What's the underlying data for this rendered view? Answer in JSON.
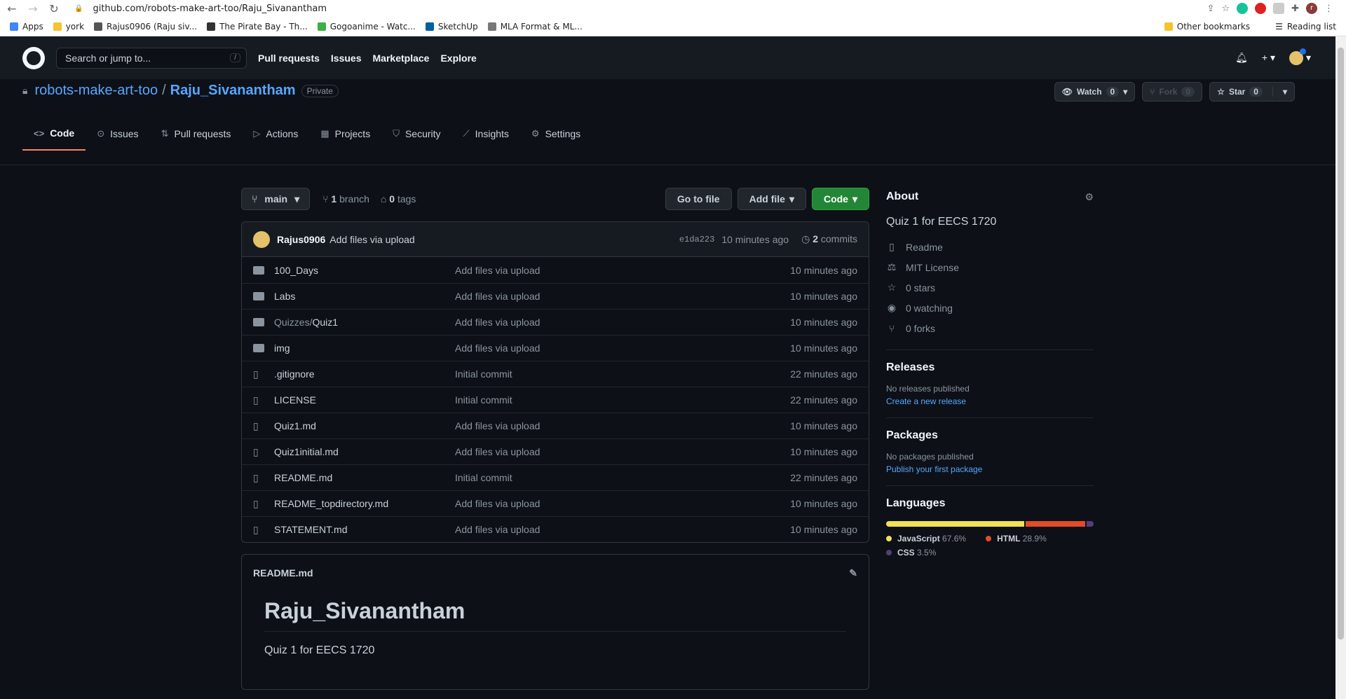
{
  "browser": {
    "url": "github.com/robots-make-art-too/Raju_Sivanantham",
    "bookmarks": [
      {
        "label": "Apps",
        "color": "#4285f4"
      },
      {
        "label": "york",
        "color": "#f4c430"
      },
      {
        "label": "Rajus0906 (Raju siv...",
        "color": "#555555"
      },
      {
        "label": "The Pirate Bay - Th...",
        "color": "#333333"
      },
      {
        "label": "Gogoanime - Watc...",
        "color": "#3cb043"
      },
      {
        "label": "SketchUp",
        "color": "#005f9e"
      },
      {
        "label": "MLA Format & ML...",
        "color": "#777777"
      }
    ],
    "other_bookmarks": "Other bookmarks",
    "reading_list": "Reading list",
    "profile_initial": "r"
  },
  "header": {
    "search_placeholder": "Search or jump to...",
    "slash": "/",
    "nav": [
      "Pull requests",
      "Issues",
      "Marketplace",
      "Explore"
    ]
  },
  "repo": {
    "owner": "robots-make-art-too",
    "name": "Raju_Sivanantham",
    "visibility": "Private",
    "watch_label": "Watch",
    "watch_count": "0",
    "fork_label": "Fork",
    "fork_count": "0",
    "star_label": "Star",
    "star_count": "0"
  },
  "tabs": [
    {
      "label": "Code",
      "icon": "code-icon"
    },
    {
      "label": "Issues",
      "icon": "issue-icon"
    },
    {
      "label": "Pull requests",
      "icon": "pull-request-icon"
    },
    {
      "label": "Actions",
      "icon": "play-icon"
    },
    {
      "label": "Projects",
      "icon": "table-icon"
    },
    {
      "label": "Security",
      "icon": "shield-icon"
    },
    {
      "label": "Insights",
      "icon": "graph-icon"
    },
    {
      "label": "Settings",
      "icon": "gear-icon"
    }
  ],
  "branch": {
    "current": "main",
    "branch_count": "1",
    "branch_word": "branch",
    "tag_count": "0",
    "tag_word": "tags",
    "go_to_file": "Go to file",
    "add_file": "Add file",
    "code": "Code"
  },
  "commit": {
    "user": "Rajus0906",
    "message": "Add files via upload",
    "sha": "e1da223",
    "age": "10 minutes ago",
    "count": "2",
    "count_word": "commits"
  },
  "files": [
    {
      "type": "dir",
      "prefix": "",
      "name": "100_Days",
      "message": "Add files via upload",
      "age": "10 minutes ago"
    },
    {
      "type": "dir",
      "prefix": "",
      "name": "Labs",
      "message": "Add files via upload",
      "age": "10 minutes ago"
    },
    {
      "type": "dir",
      "prefix": "Quizzes/",
      "name": "Quiz1",
      "message": "Add files via upload",
      "age": "10 minutes ago"
    },
    {
      "type": "dir",
      "prefix": "",
      "name": "img",
      "message": "Add files via upload",
      "age": "10 minutes ago"
    },
    {
      "type": "file",
      "prefix": "",
      "name": ".gitignore",
      "message": "Initial commit",
      "age": "22 minutes ago"
    },
    {
      "type": "file",
      "prefix": "",
      "name": "LICENSE",
      "message": "Initial commit",
      "age": "22 minutes ago"
    },
    {
      "type": "file",
      "prefix": "",
      "name": "Quiz1.md",
      "message": "Add files via upload",
      "age": "10 minutes ago"
    },
    {
      "type": "file",
      "prefix": "",
      "name": "Quiz1initial.md",
      "message": "Add files via upload",
      "age": "10 minutes ago"
    },
    {
      "type": "file",
      "prefix": "",
      "name": "README.md",
      "message": "Initial commit",
      "age": "22 minutes ago"
    },
    {
      "type": "file",
      "prefix": "",
      "name": "README_topdirectory.md",
      "message": "Add files via upload",
      "age": "10 minutes ago"
    },
    {
      "type": "file",
      "prefix": "",
      "name": "STATEMENT.md",
      "message": "Add files via upload",
      "age": "10 minutes ago"
    }
  ],
  "readme": {
    "filename": "README.md",
    "heading": "Raju_Sivanantham",
    "body": "Quiz 1 for EECS 1720"
  },
  "about": {
    "title": "About",
    "description": "Quiz 1 for EECS 1720",
    "items": [
      {
        "icon": "book-icon",
        "label": "Readme"
      },
      {
        "icon": "law-icon",
        "label": "MIT License"
      },
      {
        "icon": "star-icon",
        "label": "0 stars"
      },
      {
        "icon": "eye-icon",
        "label": "0 watching"
      },
      {
        "icon": "fork-icon",
        "label": "0 forks"
      }
    ]
  },
  "releases": {
    "title": "Releases",
    "empty": "No releases published",
    "link": "Create a new release"
  },
  "packages": {
    "title": "Packages",
    "empty": "No packages published",
    "link": "Publish your first package"
  },
  "languages": {
    "title": "Languages",
    "items": [
      {
        "name": "JavaScript",
        "percent": "67.6%",
        "value": 67.6,
        "color": "#f1e05a"
      },
      {
        "name": "HTML",
        "percent": "28.9%",
        "value": 28.9,
        "color": "#e34c26"
      },
      {
        "name": "CSS",
        "percent": "3.5%",
        "value": 3.5,
        "color": "#563d7c"
      }
    ]
  }
}
